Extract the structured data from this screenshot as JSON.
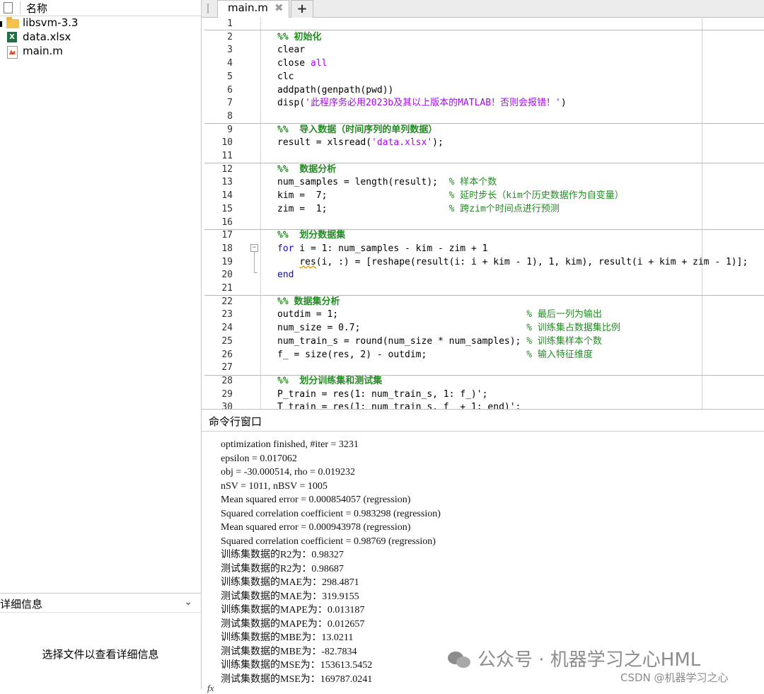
{
  "file_browser": {
    "column_name": "名称",
    "items": [
      {
        "name": "libsvm-3.3",
        "icon": "folder-icon"
      },
      {
        "name": "data.xlsx",
        "icon": "excel-file-icon",
        "badge": "X"
      },
      {
        "name": "main.m",
        "icon": "matlab-file-icon"
      }
    ]
  },
  "details": {
    "title": "详细信息",
    "chevron": "⌄",
    "message": "选择文件以查看详细信息"
  },
  "editor": {
    "tab": {
      "label": "main.m",
      "close": "✖"
    },
    "add_tab": "+",
    "fold_symbol": "−",
    "line_numbers": [
      "1",
      "2",
      "3",
      "4",
      "5",
      "6",
      "7",
      "8",
      "9",
      "10",
      "11",
      "12",
      "13",
      "14",
      "15",
      "16",
      "17",
      "18",
      "19",
      "20",
      "21",
      "22",
      "23",
      "24",
      "25",
      "26",
      "27",
      "28",
      "29",
      "30"
    ],
    "code": {
      "l2": "%% 初始化",
      "l3": "clear",
      "l4_a": "close ",
      "l4_b": "all",
      "l5": "clc",
      "l6": "addpath(genpath(pwd))",
      "l7_a": "disp(",
      "l7_b": "'此程序务必用2023b及其以上版本的MATLAB！否则会报错！'",
      "l7_c": ")",
      "l9": "%%  导入数据（时间序列的单列数据）",
      "l10_a": "result = xlsread(",
      "l10_b": "'data.xlsx'",
      "l10_c": ");",
      "l12": "%%  数据分析",
      "l13_a": "num_samples = length(result);  ",
      "l13_b": "% 样本个数",
      "l14_a": "kim =  7;                      ",
      "l14_b": "% 延时步长（kim个历史数据作为自变量）",
      "l15_a": "zim =  1;                      ",
      "l15_b": "% 跨zim个时间点进行预测",
      "l17": "%%  划分数据集",
      "l18_a": "for",
      "l18_b": " i = 1: num_samples - kim - zim + 1",
      "l19_a": "    ",
      "l19_b": "res",
      "l19_c": "(i, :) = [reshape(result(i: i + kim - 1), 1, kim), result(i + kim + zim - 1)];",
      "l20": "end",
      "l22": "%% 数据集分析",
      "l23_a": "outdim = 1;                                  ",
      "l23_b": "% 最后一列为输出",
      "l24_a": "num_size = 0.7;                              ",
      "l24_b": "% 训练集占数据集比例",
      "l25_a": "num_train_s = round(num_size * num_samples); ",
      "l25_b": "% 训练集样本个数",
      "l26_a": "f_ = size(res, 2) - outdim;                  ",
      "l26_b": "% 输入特征维度",
      "l28": "%%  划分训练集和测试集",
      "l29": "P_train = res(1: num_train_s, 1: f_)';",
      "l30": "T_train = res(1: num_train_s, f_ + 1: end)';"
    }
  },
  "command_window": {
    "title": "命令行窗口",
    "prompt": "fx",
    "output": [
      "optimization finished, #iter = 3231",
      "epsilon = 0.017062",
      "obj = -30.000514, rho = 0.019232",
      "nSV = 1011, nBSV = 1005",
      "Mean squared error = 0.000854057 (regression)",
      "Squared correlation coefficient = 0.983298 (regression)",
      "Mean squared error = 0.000943978 (regression)",
      "Squared correlation coefficient = 0.98769 (regression)",
      "训练集数据的R2为：0.98327",
      "测试集数据的R2为：0.98687",
      "训练集数据的MAE为：298.4871",
      "测试集数据的MAE为：319.9155",
      "训练集数据的MAPE为：0.013187",
      "测试集数据的MAPE为：0.012657",
      "训练集数据的MBE为：13.0211",
      "测试集数据的MBE为：-82.7834",
      "训练集数据的MSE为：153613.5452",
      "测试集数据的MSE为：169787.0241"
    ]
  },
  "watermark": {
    "main": "公众号 · 机器学习之心HML",
    "csdn": "CSDN @机器学习之心"
  }
}
